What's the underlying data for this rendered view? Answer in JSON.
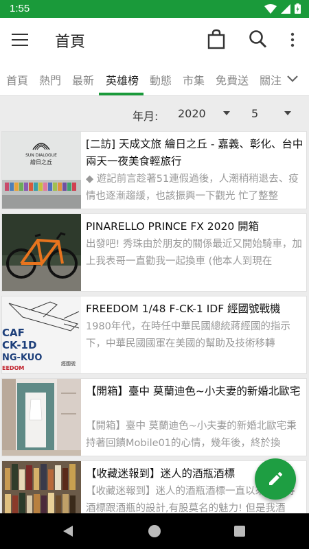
{
  "status": {
    "time": "1:55"
  },
  "appbar": {
    "title": "首頁"
  },
  "tabs": [
    {
      "label": "首頁"
    },
    {
      "label": "熱門"
    },
    {
      "label": "最新"
    },
    {
      "label": "英雄榜"
    },
    {
      "label": "動態"
    },
    {
      "label": "市集"
    },
    {
      "label": "免費送"
    },
    {
      "label": "關注"
    }
  ],
  "active_tab": "英雄榜",
  "filter": {
    "label": "年月:",
    "year": "2020",
    "month": "5"
  },
  "articles": [
    {
      "title": "[二訪] 天成文旅 繪日之丘 - 嘉義、彰化、台中 兩天一夜美食輕旅行",
      "desc": "◆ 遊記前言趁著51連假過後，人潮稍稍退去、疫情也逐漸趨緩，也該振興一下觀光 忙了整整"
    },
    {
      "title": "PINARELLO PRINCE FX 2020 開箱",
      "desc": "出發吧! 秀珠由於朋友的關係最近又開始騎車，加上我表哥一直勸我一起換車 (他本人到現在"
    },
    {
      "title": "FREEDOM 1/48 F-CK-1 IDF 經國號戰機",
      "desc": "1980年代，在時任中華民國總統蔣經國的指示下，中華民國國軍在美國的幫助及技術移轉"
    },
    {
      "title": "【開箱】臺中 莫蘭迪色~小夫妻的新婚北歐宅",
      "desc": "【開箱】臺中 莫蘭迪色~小夫妻的新婚北歐宅秉持著回饋Mobile01的心情，幾年後，終於換"
    },
    {
      "title": "【收藏迷報到】迷人的酒瓶酒標",
      "desc": "【收藏迷報到】迷人的酒瓶酒標一直以來都覺得酒標跟酒瓶的設計,有股莫名的魅力! 但是我酒"
    }
  ],
  "thumb_texts": {
    "cafe_sign": "SUN DIALOGUE",
    "cafe_sub": "繪日之丘",
    "kit_line1": "CAF",
    "kit_line2": "CK-1D",
    "kit_line3": "NG-KUO",
    "kit_brand": "EEDOM",
    "kit_side": "經國號"
  },
  "colors": {
    "primary": "#1a9a3a",
    "fab": "#1e9e42"
  },
  "icons": {
    "menu": "menu-icon",
    "bag": "shopping-bag-icon",
    "search": "search-icon",
    "more": "more-vert-icon",
    "fab": "pencil-icon"
  }
}
